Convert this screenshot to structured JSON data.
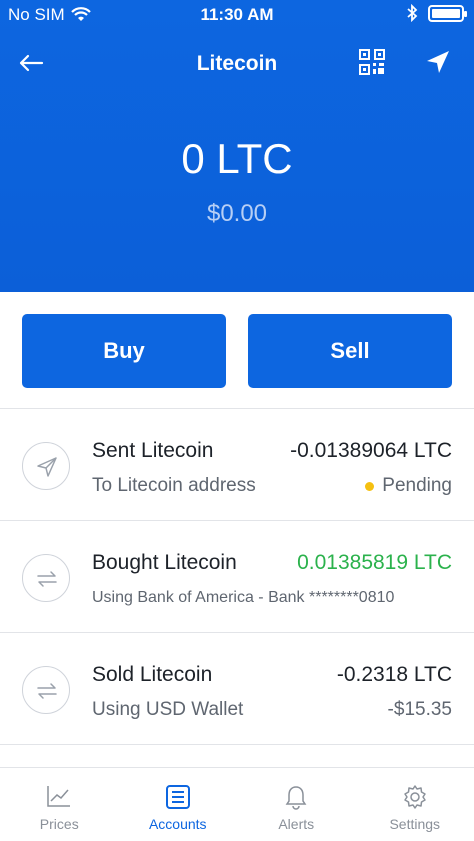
{
  "status": {
    "carrier": "No SIM",
    "time": "11:30 AM"
  },
  "header": {
    "title": "Litecoin",
    "balance": "0 LTC",
    "fiat": "$0.00"
  },
  "actions": {
    "buy": "Buy",
    "sell": "Sell"
  },
  "transactions": [
    {
      "title": "Sent Litecoin",
      "amount": "-0.01389064 LTC",
      "subtitle": "To Litecoin address",
      "status": "Pending",
      "icon": "send-icon"
    },
    {
      "title": "Bought Litecoin",
      "amount": "0.01385819 LTC",
      "subtitle": "Using Bank of America - Bank ********0810",
      "icon": "exchange-icon"
    },
    {
      "title": "Sold Litecoin",
      "amount": "-0.2318 LTC",
      "subtitle": "Using USD Wallet",
      "fiat": "-$15.35",
      "icon": "exchange-icon"
    }
  ],
  "tabs": [
    {
      "label": "Prices",
      "icon": "chart-icon"
    },
    {
      "label": "Accounts",
      "icon": "accounts-icon",
      "active": true
    },
    {
      "label": "Alerts",
      "icon": "bell-icon"
    },
    {
      "label": "Settings",
      "icon": "gear-icon"
    }
  ],
  "colors": {
    "brand": "#0d66e0",
    "positive": "#2bb24c",
    "pending": "#f5c011"
  }
}
